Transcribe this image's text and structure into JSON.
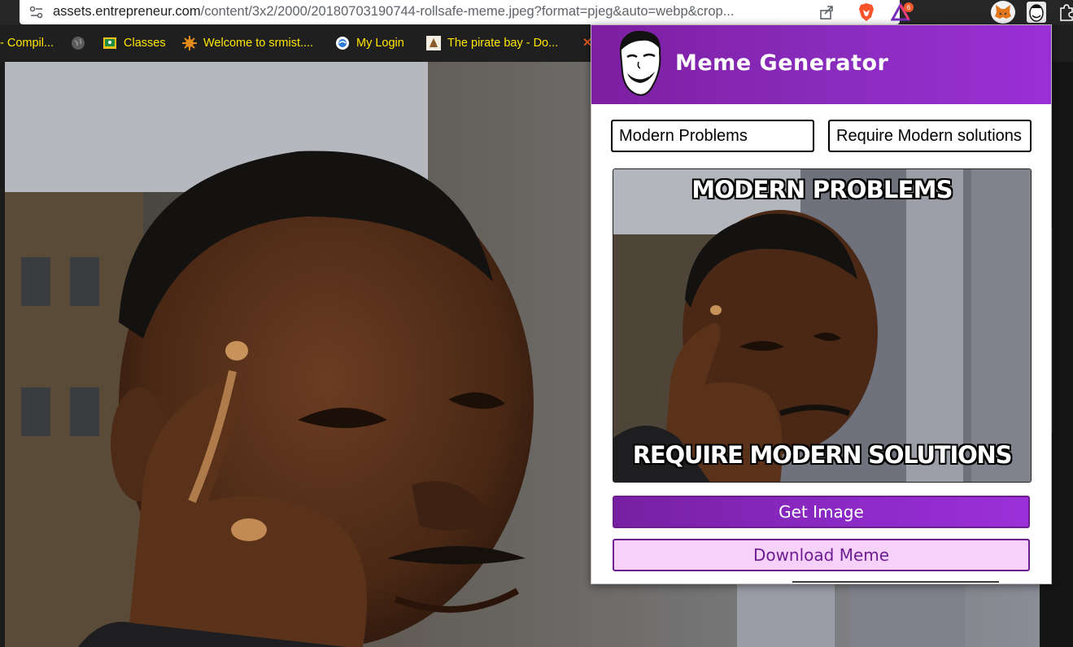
{
  "browser": {
    "url_domain": "assets.entrepreneur.com",
    "url_path": "/content/3x2/2000/20180703190744-rollsafe-meme.jpeg?format=pjeg&auto=webp&crop...",
    "rewards_badge": "6",
    "bookmarks": [
      {
        "label": "- Compil...",
        "icon": "compiler-icon"
      },
      {
        "label": "",
        "icon": "globe-icon"
      },
      {
        "label": "Classes",
        "icon": "classroom-icon"
      },
      {
        "label": "Welcome to srmist....",
        "icon": "srm-icon"
      },
      {
        "label": "My Login",
        "icon": "login-icon"
      },
      {
        "label": "The pirate bay - Do...",
        "icon": "pirate-bay-icon"
      }
    ]
  },
  "popup": {
    "title": "Meme Generator",
    "top_text_value": "Modern Problems",
    "bottom_text_value": "Require Modern solutions",
    "meme_top_caption": "MODERN PROBLEMS",
    "meme_bottom_caption": "REQUIRE MODERN SOLUTIONS",
    "get_image_label": "Get Image",
    "download_label": "Download Meme"
  },
  "colors": {
    "accent_purple": "#8a2cbe",
    "download_bg": "#f6d2fb",
    "bookmark_text": "#ffe600"
  }
}
